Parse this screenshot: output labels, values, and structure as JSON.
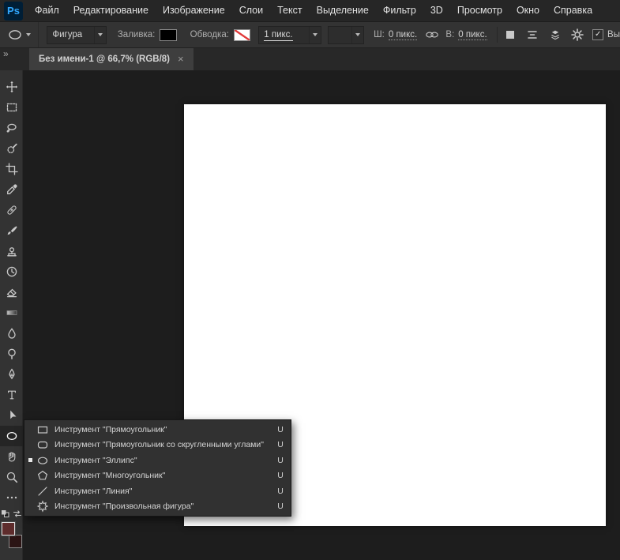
{
  "app": {
    "logo": "Ps"
  },
  "menubar": {
    "items": [
      "Файл",
      "Редактирование",
      "Изображение",
      "Слои",
      "Текст",
      "Выделение",
      "Фильтр",
      "3D",
      "Просмотр",
      "Окно",
      "Справка"
    ]
  },
  "options_bar": {
    "tool_mode_value": "Фигура",
    "fill_label": "Заливка:",
    "stroke_label": "Обводка:",
    "stroke_width_value": "1 пикс.",
    "width_label": "Ш:",
    "width_value": "0 пикс.",
    "height_label": "В:",
    "height_value": "0 пикс.",
    "checkbox_checked": "✓",
    "align_edges_label": "Вы",
    "icons": [
      "ellipse-preset-icon",
      "link-dimensions-icon",
      "path-operations-icon",
      "path-align-icon",
      "path-arrange-icon",
      "gear-icon"
    ]
  },
  "tab": {
    "title": "Без имени-1 @ 66,7% (RGB/8)",
    "close": "×"
  },
  "toolbar": {
    "collapse": "»",
    "tools": [
      "move-tool",
      "rect-marquee-tool",
      "lasso-tool",
      "quick-selection-tool",
      "crop-tool",
      "eyedropper-tool",
      "healing-brush-tool",
      "brush-tool",
      "clone-stamp-tool",
      "history-brush-tool",
      "eraser-tool",
      "gradient-tool",
      "blur-tool",
      "dodge-tool",
      "pen-tool",
      "type-tool",
      "path-selection-tool",
      "ellipse-tool",
      "hand-tool",
      "zoom-tool",
      "more-tools"
    ]
  },
  "flyout": {
    "items": [
      {
        "label": "Инструмент \"Прямоугольник\"",
        "shortcut": "U",
        "selected": false
      },
      {
        "label": "Инструмент \"Прямоугольник со скругленными углами\"",
        "shortcut": "U",
        "selected": false
      },
      {
        "label": "Инструмент \"Эллипс\"",
        "shortcut": "U",
        "selected": true
      },
      {
        "label": "Инструмент \"Многоугольник\"",
        "shortcut": "U",
        "selected": false
      },
      {
        "label": "Инструмент \"Линия\"",
        "shortcut": "U",
        "selected": false
      },
      {
        "label": "Инструмент \"Произвольная фигура\"",
        "shortcut": "U",
        "selected": false
      }
    ]
  },
  "colors": {
    "accent_blue": "#31a8ff",
    "fill_swatch": "#000000",
    "stroke_none_slash": "#e03a3a",
    "foreground_swatch": "#5e2c2c",
    "background_swatch": "#2b1414",
    "canvas": "#ffffff",
    "workspace": "#1d1d1d"
  }
}
